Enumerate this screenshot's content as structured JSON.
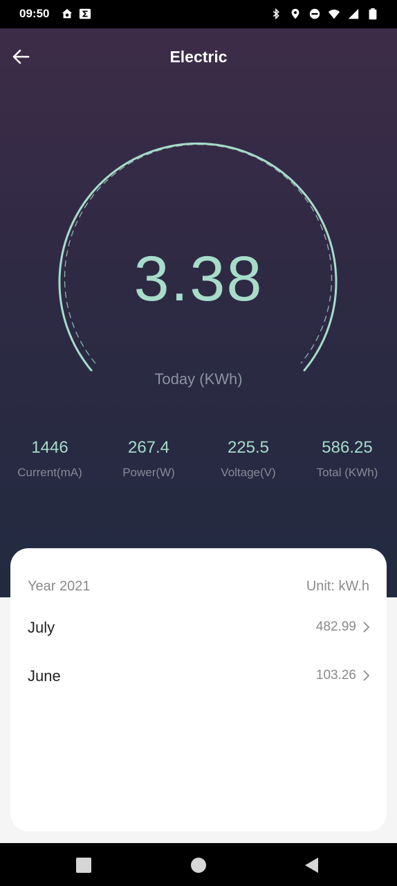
{
  "status_bar": {
    "time": "09:50",
    "left_icons": [
      "home-app-icon",
      "sigma-app-icon"
    ],
    "right_icons": [
      "bluetooth-icon",
      "location-icon",
      "do-not-disturb-icon",
      "wifi-icon",
      "cell-signal-icon",
      "battery-icon"
    ]
  },
  "header": {
    "title": "Electric"
  },
  "gauge": {
    "value": "3.38",
    "label": "Today (KWh)"
  },
  "stats": [
    {
      "value": "1446",
      "label": "Current(mA)"
    },
    {
      "value": "267.4",
      "label": "Power(W)"
    },
    {
      "value": "225.5",
      "label": "Voltage(V)"
    },
    {
      "value": "586.25",
      "label": "Total (KWh)"
    }
  ],
  "history": {
    "year_label": "Year 2021",
    "unit_label": "Unit: kW.h",
    "months": [
      {
        "name": "July",
        "value": "482.99"
      },
      {
        "name": "June",
        "value": "103.26"
      }
    ]
  },
  "colors": {
    "accent": "#a7dcc9",
    "header_top": "#3d2c48",
    "header_bottom": "#222a40",
    "card_bg": "#ffffff"
  }
}
